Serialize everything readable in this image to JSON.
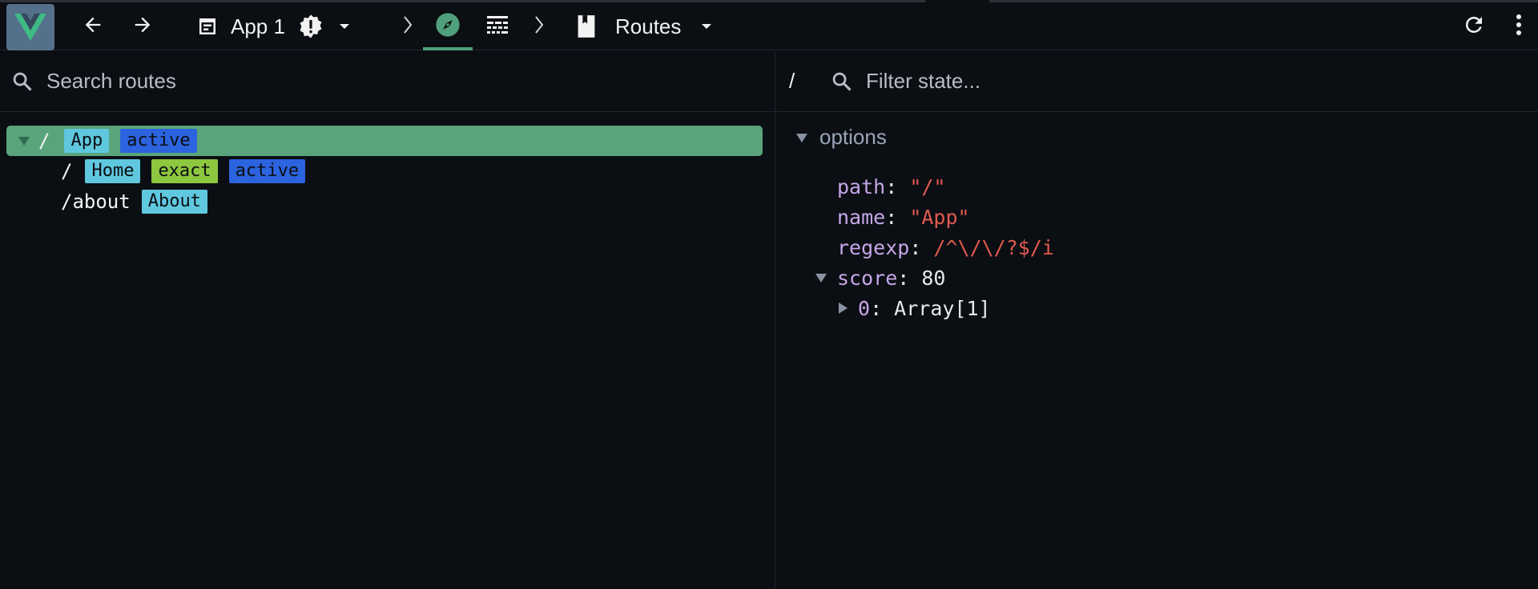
{
  "toolbar": {
    "app_selector_label": "App 1",
    "inspector_selector_label": "Routes",
    "icons": {
      "logo": "vue-logo",
      "back": "arrow-left-icon",
      "forward": "arrow-right-icon",
      "app": "app-window-icon",
      "warning": "warning-badge-icon",
      "dropdown": "chevron-down-icon",
      "separator": "chevron-right-icon",
      "router": "compass-icon",
      "timeline": "timeline-icon",
      "routes": "book-icon",
      "refresh": "refresh-icon",
      "more": "more-vert-icon"
    },
    "colors": {
      "logo_bg": "#55708a",
      "logo_green": "#3fba84",
      "active_tab": "#4fa07a"
    }
  },
  "routes_pane": {
    "search_placeholder": "Search routes",
    "routes": [
      {
        "path": "/",
        "badges": [
          {
            "label": "App",
            "kind": "cyan"
          },
          {
            "label": "active",
            "kind": "blue"
          }
        ],
        "selected": true,
        "expanded": true
      },
      {
        "path": "/",
        "badges": [
          {
            "label": "Home",
            "kind": "cyan"
          },
          {
            "label": "exact",
            "kind": "lime"
          },
          {
            "label": "active",
            "kind": "blue"
          }
        ],
        "selected": false
      },
      {
        "path": "/about",
        "badges": [
          {
            "label": "About",
            "kind": "cyan"
          }
        ],
        "selected": false
      }
    ]
  },
  "state_pane": {
    "current_path": "/",
    "filter_placeholder": "Filter state...",
    "section_label": "options",
    "props": {
      "path": {
        "key": "path",
        "value": "\"/\""
      },
      "name": {
        "key": "name",
        "value": "\"App\""
      },
      "regexp": {
        "key": "regexp",
        "value": "/^\\/\\/?$/i"
      },
      "score": {
        "key": "score",
        "value": "80"
      },
      "score_0": {
        "key": "0",
        "value": "Array[1]"
      }
    }
  }
}
